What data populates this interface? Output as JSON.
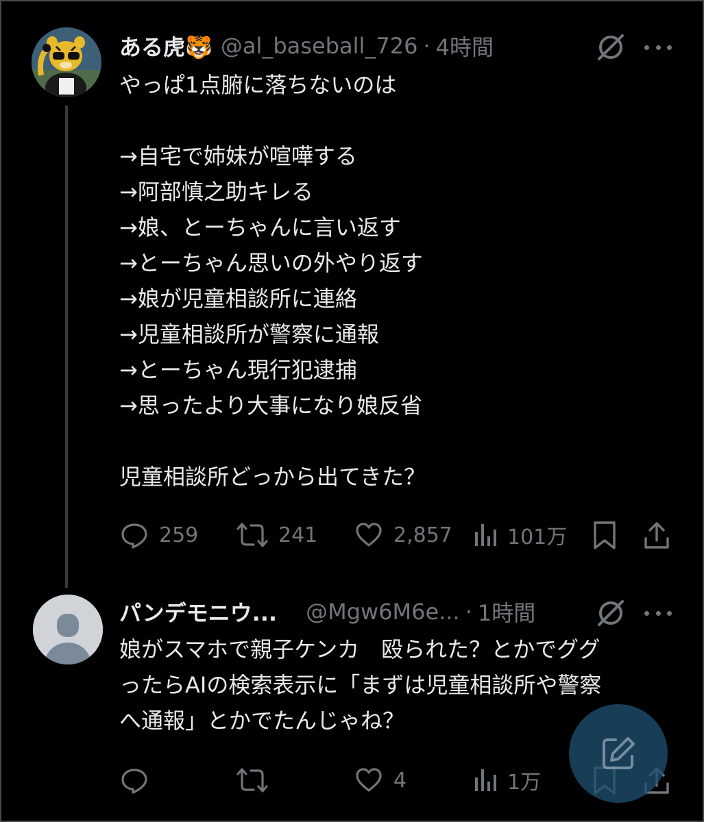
{
  "post": {
    "author_name": "ある虎🐯",
    "handle": "@al_baseball_726",
    "separator": "·",
    "time": "4時間",
    "text_lines": [
      "やっぱ1点腑に落ちないのは",
      "",
      "→自宅で姉妹が喧嘩する",
      "→阿部慎之助キレる",
      "→娘、とーちゃんに言い返す",
      "→とーちゃん思いの外やり返す",
      "→娘が児童相談所に連絡",
      "→児童相談所が警察に通報",
      "→とーちゃん現行犯逮捕",
      "→思ったより大事になり娘反省",
      "",
      "児童相談所どっから出てきた？"
    ],
    "stats": {
      "replies": "259",
      "reposts": "241",
      "likes": "2,857",
      "views": "101万"
    }
  },
  "reply": {
    "author_name": "パンデモニウ...",
    "handle": "@Mgw6M6e...",
    "separator": "·",
    "time": "1時間",
    "text_lines": [
      "娘がスマホで親子ケンカ　殴られた？とかでググ",
      "ったらAIの検索表示に「まずは児童相談所や警察",
      "へ通報」とかでたんじゃね？"
    ],
    "stats": {
      "likes": "4",
      "views": "1万"
    }
  },
  "colors": {
    "background": "#000000",
    "text": "#e7e9ea",
    "secondary": "#71767b",
    "fab": "#1d4e70"
  },
  "icons": {
    "grok": "grok-icon",
    "more": "more-dots-icon",
    "reply": "reply-icon",
    "repost": "repost-icon",
    "like": "heart-icon",
    "views": "views-icon",
    "bookmark": "bookmark-icon",
    "share": "share-icon",
    "compose": "compose-icon"
  }
}
